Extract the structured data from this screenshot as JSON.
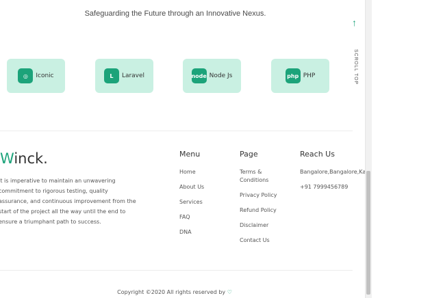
{
  "section": {
    "tagline": "Safeguarding the Future through an Innovative Nexus."
  },
  "tech_stack": [
    {
      "label": "Iconic",
      "icon": "ionic-icon",
      "glyph": "◎"
    },
    {
      "label": "Laravel",
      "icon": "laravel-icon",
      "glyph": "L"
    },
    {
      "label": "Node Js",
      "icon": "nodejs-icon",
      "glyph": "node"
    },
    {
      "label": "PHP",
      "icon": "php-icon",
      "glyph": "php"
    }
  ],
  "scroll_top": {
    "label": "SCROLL TOP"
  },
  "brand": {
    "first": "W",
    "rest": "inck."
  },
  "about": {
    "text": "It is imperative to maintain an unwavering commitment to rigorous testing, quality assurance, and continuous improvement from the start of the project all the way until the end to ensure a triumphant path to success."
  },
  "menu": {
    "heading": "Menu",
    "items": [
      "Home",
      "About Us",
      "Services",
      "FAQ",
      "DNA"
    ]
  },
  "page": {
    "heading": "Page",
    "items": [
      "Terms & Conditions",
      "Privacy Policy",
      "Refund Policy",
      "Disclaimer",
      "Contact Us"
    ]
  },
  "reach": {
    "heading": "Reach Us",
    "address": "Bangalore,Bangalore,Ka",
    "phone": "+91 7999456789"
  },
  "footer": {
    "copyright": "Copyright ©2020 All rights reserved by ",
    "heart": "♡"
  },
  "colors": {
    "accent": "#1ca37a",
    "card_bg": "#c9f0e2"
  }
}
